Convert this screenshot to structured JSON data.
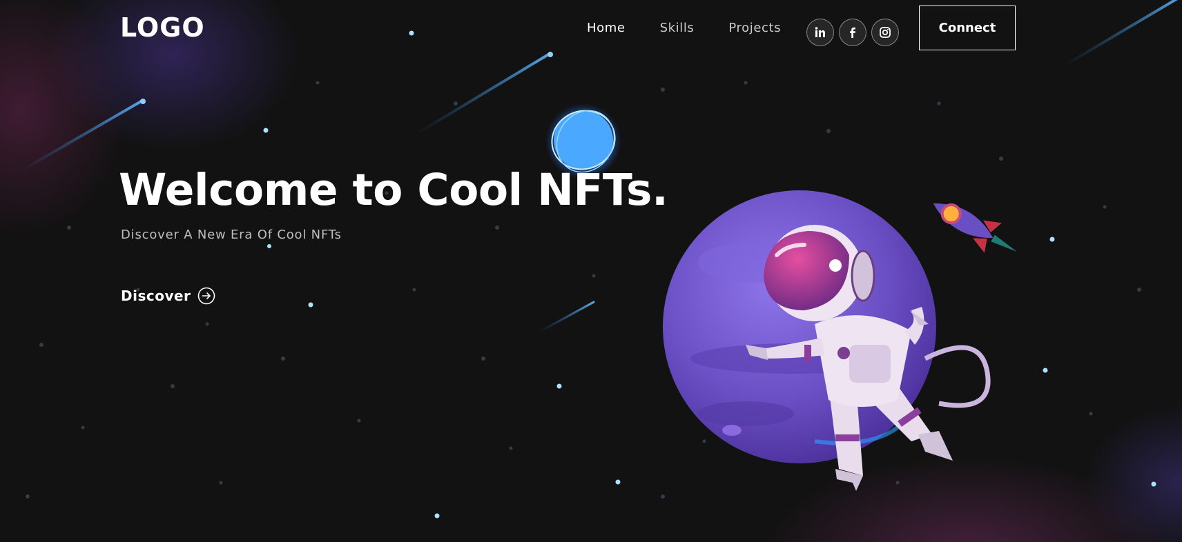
{
  "header": {
    "logo_text": "LOGO",
    "nav": [
      {
        "label": "Home",
        "active": true
      },
      {
        "label": "Skills",
        "active": false
      },
      {
        "label": "Projects",
        "active": false
      }
    ],
    "social": [
      {
        "icon": "linkedin-icon"
      },
      {
        "icon": "facebook-icon"
      },
      {
        "icon": "instagram-icon"
      }
    ],
    "connect_label": "Connect"
  },
  "hero": {
    "title": "Welcome to Cool NFTs.",
    "subtitle": "Discover A New Era Of Cool NFTs",
    "cta_label": "Discover",
    "cta_icon": "arrow-right-circle-icon"
  },
  "colors": {
    "background": "#121212",
    "text": "#ffffff",
    "planet": "#6a4fc4",
    "glow_orb": "#4aa8ff",
    "astronaut_visor": "#a0306a"
  }
}
